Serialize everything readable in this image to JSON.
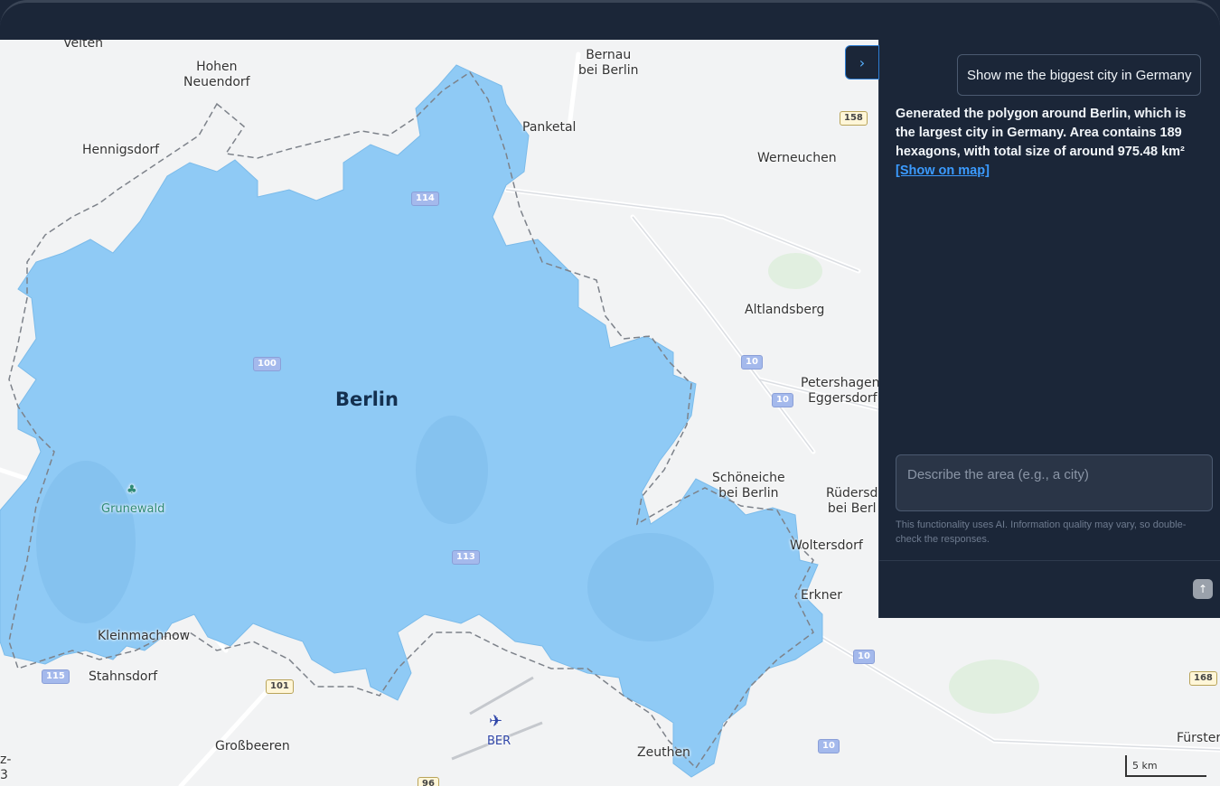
{
  "map": {
    "region_label": "Berlin",
    "places": [
      "Velten",
      "Hohen\nNeuendorf",
      "Bernau\nbei Berlin",
      "Panketal",
      "Hennigsdorf",
      "Werneuchen",
      "Altlandsberg",
      "Petershagen-\nEggersdorf",
      "Schöneiche\nbei Berlin",
      "Rüdersd\nbei Berl",
      "Woltersdorf",
      "Erkner",
      "Kleinmachnow",
      "Stahnsdorf",
      "Großbeeren",
      "Zeuthen",
      "Fürster",
      "z-\n3"
    ],
    "park": "Grunewald",
    "airport": "BER",
    "road_shields": [
      "158",
      "114",
      "100",
      "10",
      "10",
      "113",
      "10",
      "115",
      "101",
      "10",
      "168",
      "96"
    ],
    "scale": "5 km",
    "polygon_color": "#8fcaf5"
  },
  "panel": {
    "collapse_icon": "chevron-right-icon",
    "user_message": "Show me the biggest city in Germany",
    "reply_text": "Generated the polygon around Berlin, which is the largest city in Germany. Area contains 189 hexagons, with total size of around 975.48 km²",
    "reply_link": "[Show on map]",
    "input_placeholder": "Describe the area (e.g., a city)",
    "disclaimer": "This functionality uses AI. Information quality may vary, so double-check the responses.",
    "send_icon": "arrow-up-icon"
  }
}
